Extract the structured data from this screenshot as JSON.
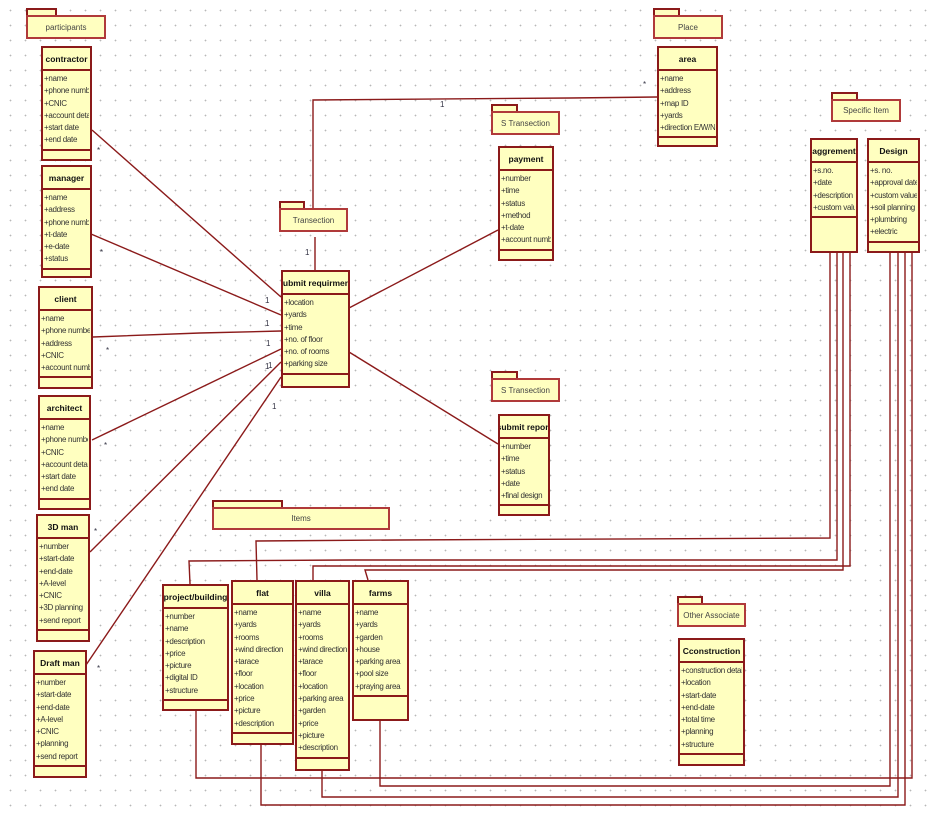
{
  "packages": [
    {
      "label": "participants"
    },
    {
      "label": "Place"
    },
    {
      "label": "Transection"
    },
    {
      "label": "S Transection"
    },
    {
      "label": "Specific Item"
    },
    {
      "label": "S Transection"
    },
    {
      "label": "Items"
    },
    {
      "label": "Other Associate"
    }
  ],
  "classes": [
    {
      "name": "contractor",
      "attributes": [
        "+name",
        "+phone number",
        "+CNIC",
        "+account details",
        "+start date",
        "+end date"
      ]
    },
    {
      "name": "manager",
      "attributes": [
        "+name",
        "+address",
        "+phone number",
        "+t-date",
        "+e-date",
        "+status"
      ]
    },
    {
      "name": "client",
      "attributes": [
        "+name",
        "+phone number",
        "+address",
        "+CNIC",
        "+account number"
      ]
    },
    {
      "name": "architect",
      "attributes": [
        "+name",
        "+phone number",
        "+CNIC",
        "+account details",
        "+start date",
        "+end date"
      ]
    },
    {
      "name": "3D man",
      "attributes": [
        "+number",
        "+start-date",
        "+end-date",
        "+A-level",
        "+CNIC",
        "+3D planning",
        "+send report"
      ]
    },
    {
      "name": "Draft man",
      "attributes": [
        "+number",
        "+start-date",
        "+end-date",
        "+A-level",
        "+CNIC",
        "+planning",
        "+send report"
      ]
    },
    {
      "name": "submit requirment",
      "attributes": [
        "+location",
        "+yards",
        "+time",
        "+no. of floor",
        "+no. of rooms",
        "+parking size"
      ]
    },
    {
      "name": "area",
      "attributes": [
        "+name",
        "+address",
        "+map ID",
        "+yards",
        "+direction E/W/N/S"
      ]
    },
    {
      "name": "payment",
      "attributes": [
        "+number",
        "+time",
        "+status",
        "+method",
        "+t-date",
        "+account number"
      ]
    },
    {
      "name": "aggrement",
      "attributes": [
        "+s.no.",
        "+date",
        "+description",
        "+custom value"
      ]
    },
    {
      "name": "Design",
      "attributes": [
        "+s. no.",
        "+approval date",
        "+custom value",
        "+soil planning",
        "+plumbring",
        "+electric"
      ]
    },
    {
      "name": "submit report",
      "attributes": [
        "+number",
        "+time",
        "+status",
        "+date",
        "+final design"
      ]
    },
    {
      "name": "project/building",
      "attributes": [
        "+number",
        "+name",
        "+description",
        "+price",
        "+picture",
        "+digital ID",
        "+structure"
      ]
    },
    {
      "name": "flat",
      "attributes": [
        "+name",
        "+yards",
        "+rooms",
        "+wind direction",
        "+tarace",
        "+floor",
        "+location",
        "+price",
        "+picture",
        "+description"
      ]
    },
    {
      "name": "villa",
      "attributes": [
        "+name",
        "+yards",
        "+rooms",
        "+wind direction",
        "+tarace",
        "+floor",
        "+location",
        "+parking area",
        "+garden",
        "+price",
        "+picture",
        "+description"
      ]
    },
    {
      "name": "farms",
      "attributes": [
        "+name",
        "+yards",
        "+garden",
        "+house",
        "+parking area",
        "+pool size",
        "+praying area"
      ]
    },
    {
      "name": "Cconstruction",
      "attributes": [
        "+construction details",
        "+location",
        "+start-date",
        "+end-date",
        "+total time",
        "+planning",
        "+structure"
      ]
    }
  ],
  "multiplicities": [
    "*",
    "*",
    "*",
    "*",
    "*",
    "*",
    "1",
    "1",
    "1",
    "1",
    "1",
    "1",
    "1",
    "1",
    "*"
  ],
  "colors": {
    "class_fill": "#ffffc0",
    "border": "#8b1a1a"
  }
}
